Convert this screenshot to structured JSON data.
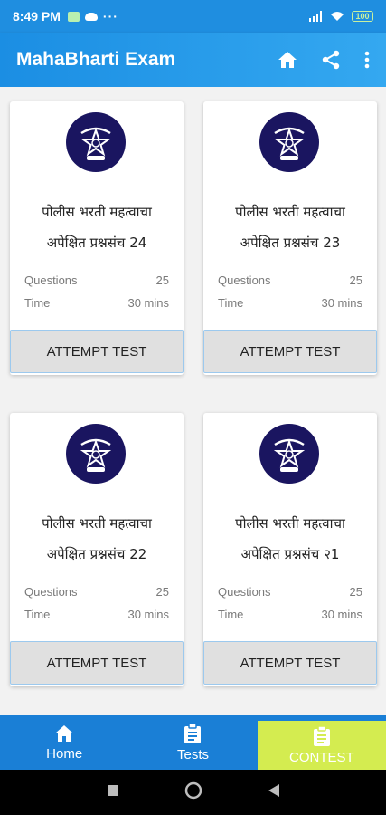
{
  "status_bar": {
    "time": "8:49 PM",
    "dots": "···",
    "battery": "100"
  },
  "app_bar": {
    "title": "MahaBharti Exam",
    "icons": [
      "home-icon",
      "share-icon",
      "more-vert-icon"
    ]
  },
  "cards": [
    {
      "title_line1": "पोलीस भरती महत्वाचा",
      "title_line2": "अपेक्षित प्रश्नसंच 24",
      "questions_label": "Questions",
      "questions_value": "25",
      "time_label": "Time",
      "time_value": "30 mins",
      "button": "ATTEMPT TEST"
    },
    {
      "title_line1": "पोलीस भरती महत्वाचा",
      "title_line2": "अपेक्षित प्रश्नसंच 23",
      "questions_label": "Questions",
      "questions_value": "25",
      "time_label": "Time",
      "time_value": "30 mins",
      "button": "ATTEMPT TEST"
    },
    {
      "title_line1": "पोलीस भरती महत्वाचा",
      "title_line2": "अपेक्षित प्रश्नसंच 22",
      "questions_label": "Questions",
      "questions_value": "25",
      "time_label": "Time",
      "time_value": "30 mins",
      "button": "ATTEMPT TEST"
    },
    {
      "title_line1": "पोलीस भरती महत्वाचा",
      "title_line2": "अपेक्षित प्रश्नसंच २1",
      "questions_label": "Questions",
      "questions_value": "25",
      "time_label": "Time",
      "time_value": "30 mins",
      "button": "ATTEMPT TEST"
    }
  ],
  "bottom_nav": {
    "home": {
      "label": "Home",
      "icon": "home-icon"
    },
    "tests": {
      "label": "Tests",
      "icon": "clipboard-icon"
    },
    "contest": {
      "label": "CONTEST",
      "icon": "clipboard-icon",
      "color": "#d4ec50"
    }
  },
  "colors": {
    "primary": "#1f8ee0",
    "nav": "#1a7fd6",
    "logo_bg": "#1a1560"
  }
}
